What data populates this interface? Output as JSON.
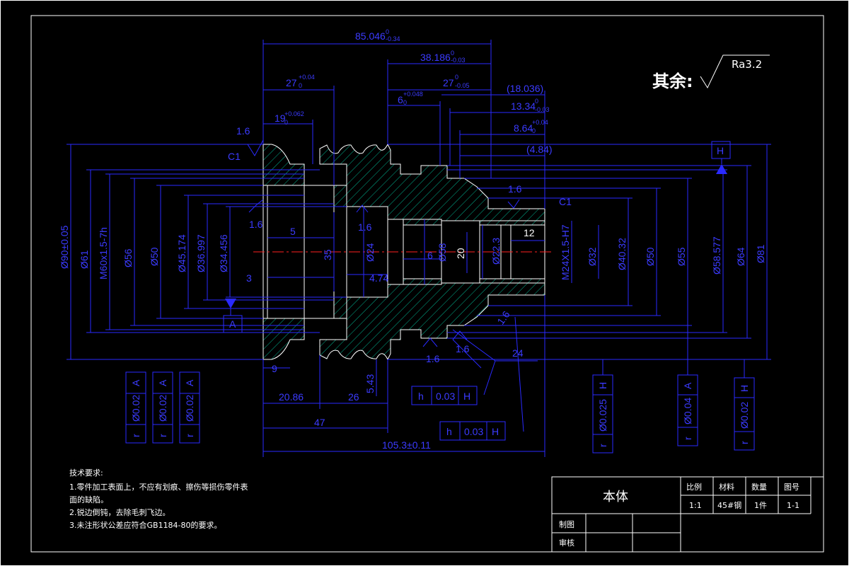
{
  "surface_finish": {
    "label": "其余:",
    "value": "Ra3.2"
  },
  "dimensions": {
    "top": [
      "85.046",
      "38.186",
      "27",
      "27",
      "6",
      "19",
      "(18.036)",
      "13.34",
      "8.64",
      "(4.84)"
    ],
    "top_tol": [
      "0",
      "-0.34",
      "0",
      "-0.03",
      "+0.04",
      "0",
      "0",
      "-0.05",
      "+0.048",
      "0",
      "+0.062",
      "0",
      "0",
      "-0.03",
      "+0.04",
      "0"
    ],
    "left_dia": [
      "Ø90±0.05",
      "Ø61",
      "M60x1.5-7h",
      "Ø56",
      "Ø50",
      "Ø45.174",
      "Ø36.997",
      "Ø34.456"
    ],
    "right_dia": [
      "M24X1.5-H7",
      "Ø32",
      "Ø40.32",
      "Ø50",
      "Ø55",
      "Ø58.577",
      "Ø64",
      "Ø81"
    ],
    "inner": [
      "5",
      "3",
      "35",
      "Ø24",
      "4.74",
      "6",
      "Ø58",
      "20",
      "Ø22.3",
      "12"
    ],
    "bottom": [
      "9",
      "20.86",
      "26",
      "5.43",
      "47",
      "105.3±0.11",
      "24"
    ],
    "roughness": [
      "1.6",
      "1.6",
      "1.6",
      "1.6",
      "1.6",
      "1.6",
      "1.6"
    ],
    "chamfer": [
      "C1",
      "C1"
    ],
    "datum": [
      "A",
      "H"
    ]
  },
  "tolerance_frames": {
    "left": [
      {
        "symbol": "r",
        "value": "Ø0.02",
        "datum": "A"
      },
      {
        "symbol": "r",
        "value": "Ø0.02",
        "datum": "A"
      },
      {
        "symbol": "r",
        "value": "Ø0.02",
        "datum": "A"
      }
    ],
    "flat": [
      {
        "symbol": "h",
        "value": "0.03",
        "datum": "H"
      },
      {
        "symbol": "h",
        "value": "0.03",
        "datum": "H"
      }
    ],
    "right": [
      {
        "symbol": "r",
        "value": "Ø0.025",
        "datum": "H"
      },
      {
        "symbol": "r",
        "value": "Ø0.04",
        "datum": "A"
      },
      {
        "symbol": "r",
        "value": "Ø0.02",
        "datum": "H"
      }
    ]
  },
  "notes": {
    "title": "技术要求:",
    "lines": [
      "1.零件加工表面上，不应有划痕、擦伤等损伤零件表",
      "面的缺陷。",
      "2.锐边倒钝，去除毛刺飞边。",
      "3.未注形状公差应符合GB1184-80的要求。"
    ]
  },
  "title_block": {
    "part_name": "本体",
    "headers": [
      "比例",
      "材料",
      "数量",
      "图号"
    ],
    "values": [
      "1:1",
      "45#钢",
      "1件",
      "1-1"
    ],
    "drawn_label": "制图",
    "checked_label": "审核"
  }
}
